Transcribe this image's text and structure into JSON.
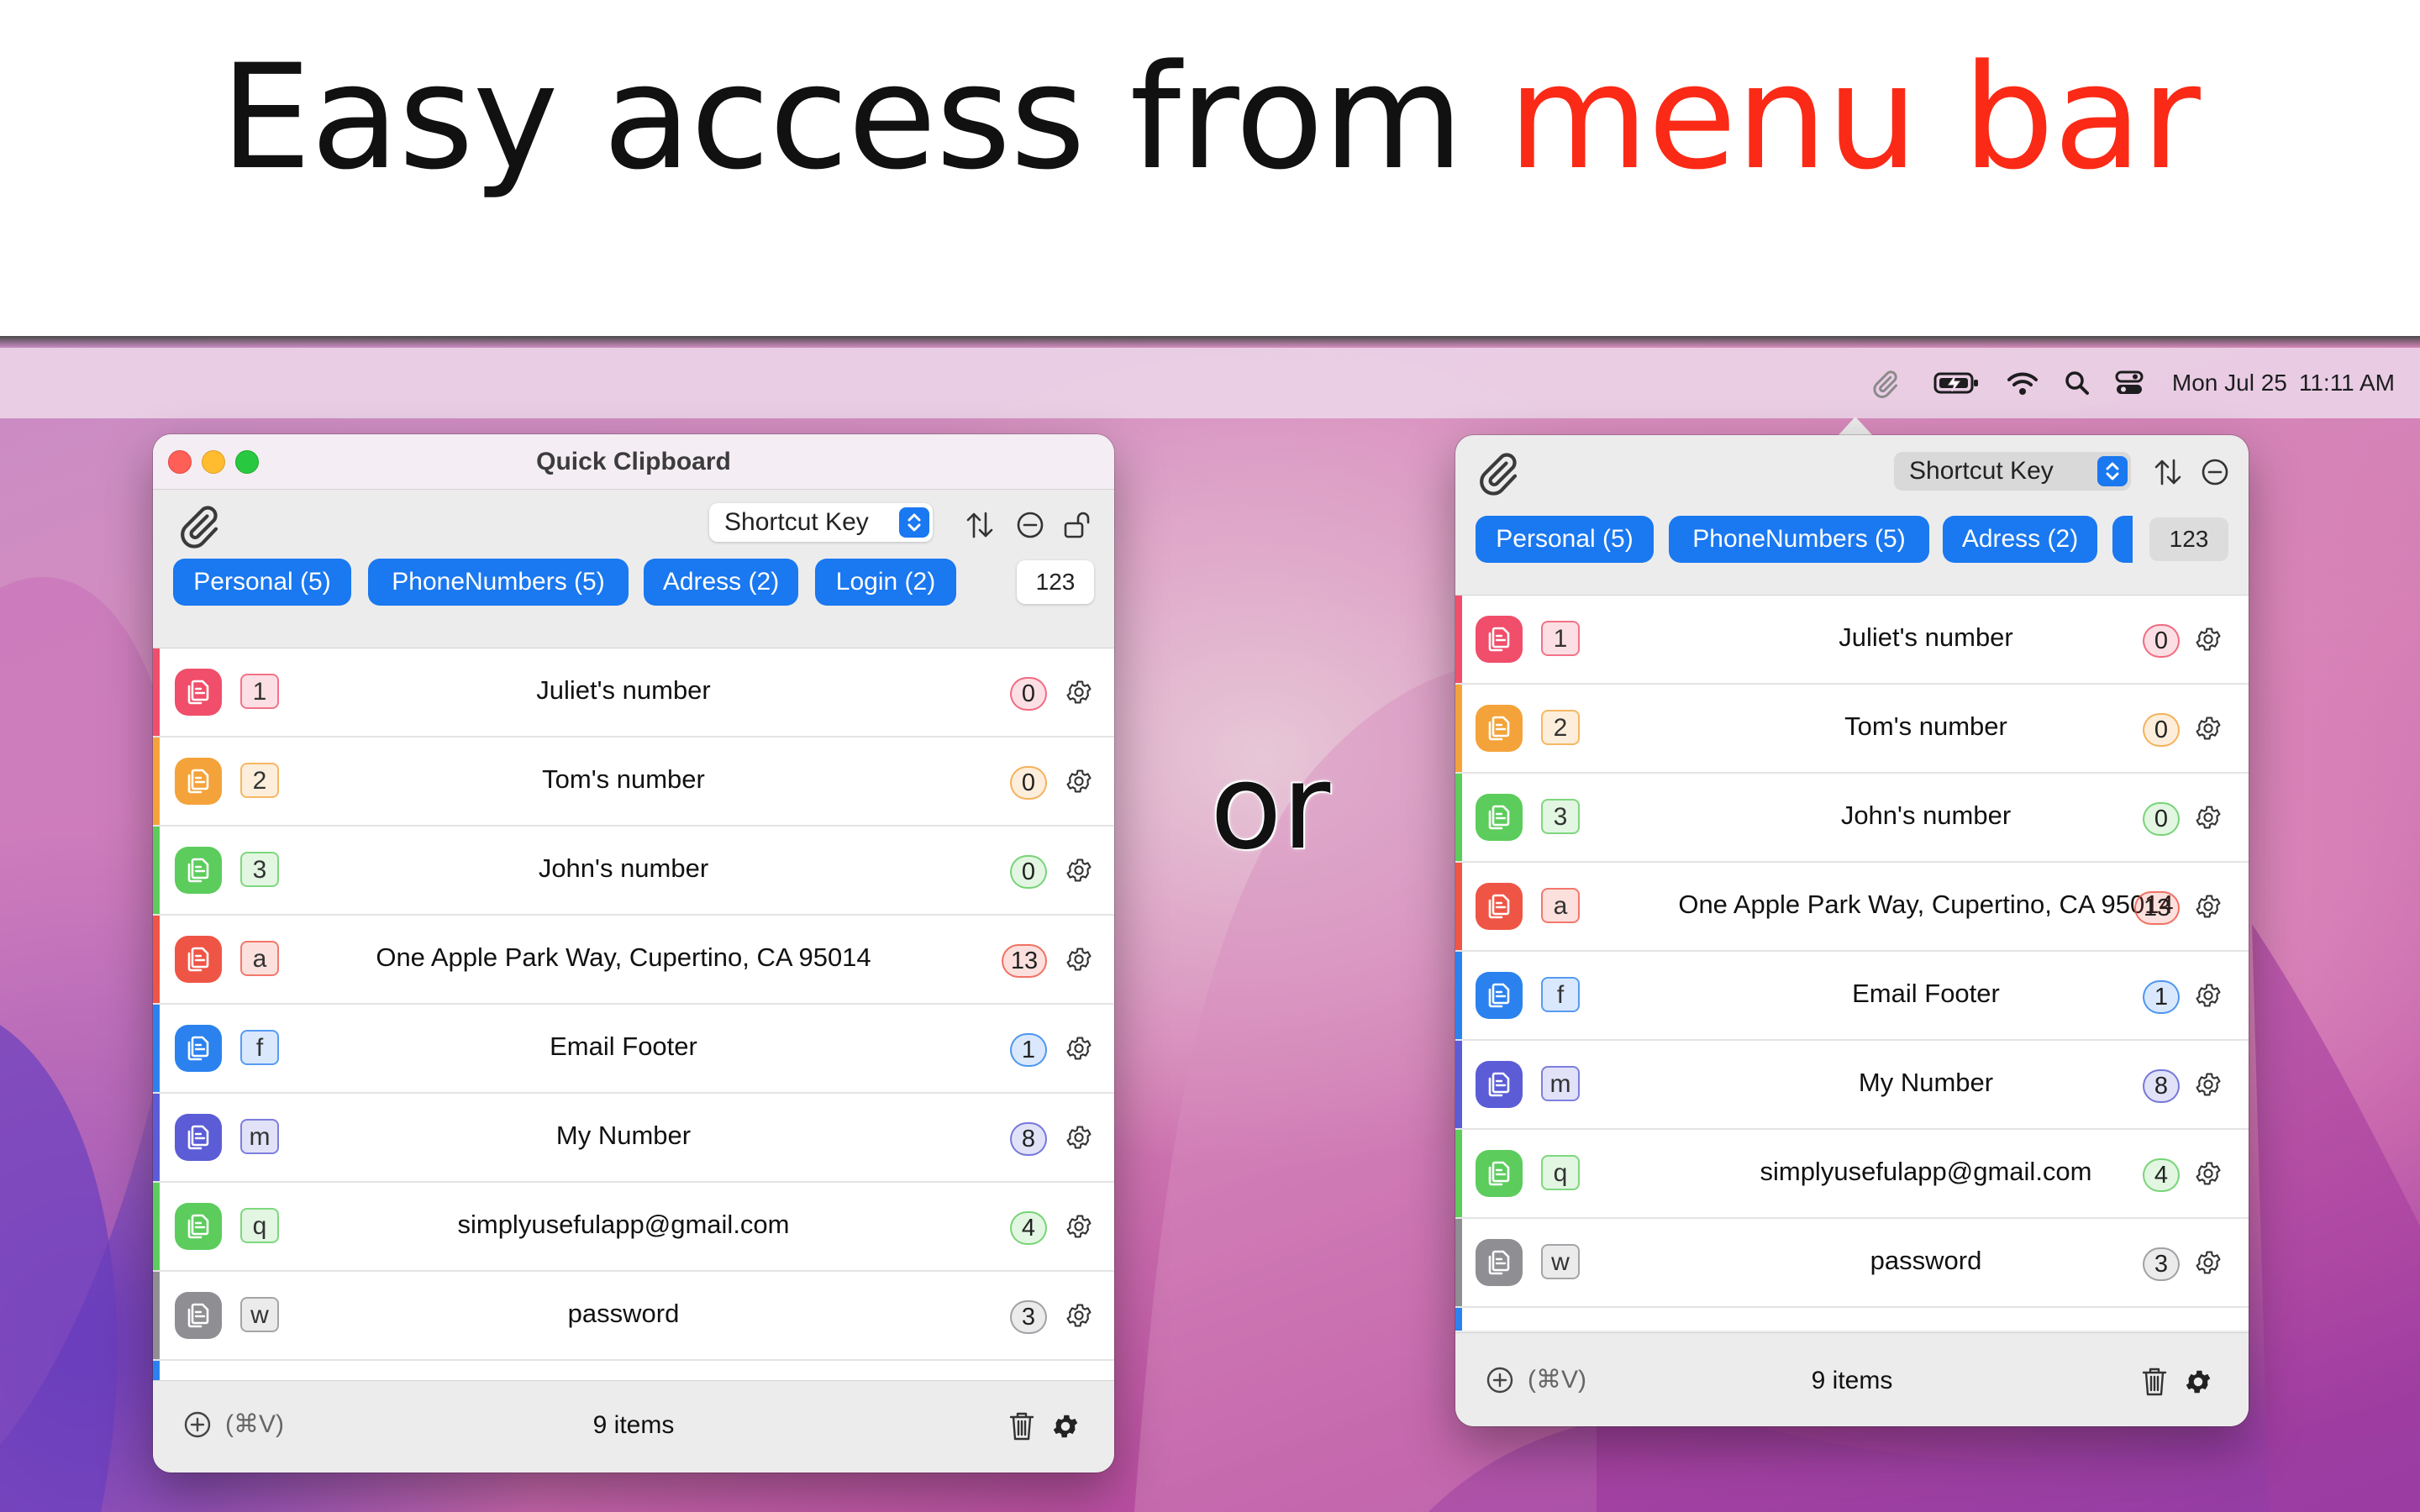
{
  "headline": {
    "text": "Easy access from ",
    "accent": "menu bar",
    "accent_color": "#fa2a17"
  },
  "separator_word": "or",
  "menubar": {
    "icons": [
      "paperclip-icon",
      "battery-charging-icon",
      "wifi-icon",
      "search-icon",
      "control-center-icon"
    ],
    "date": "Mon Jul 25",
    "time": "11:11 AM"
  },
  "app": {
    "window_title": "Quick Clipboard",
    "sort_select": "Shortcut Key",
    "tabs": [
      {
        "label": "Personal (5)"
      },
      {
        "label": "PhoneNumbers (5)"
      },
      {
        "label": "Adress (2)"
      },
      {
        "label": "Login (2)"
      }
    ],
    "count_box": "123",
    "items": [
      {
        "key": "1",
        "name": "Juliet's number",
        "uses": "0",
        "color": "#f04e6a"
      },
      {
        "key": "2",
        "name": "Tom's number",
        "uses": "0",
        "color": "#f4a33a"
      },
      {
        "key": "3",
        "name": "John's number",
        "uses": "0",
        "color": "#5ccc5c"
      },
      {
        "key": "a",
        "name": "One Apple Park Way, Cupertino, CA 95014",
        "uses": "13",
        "color": "#ef5545"
      },
      {
        "key": "f",
        "name": "Email Footer",
        "uses": "1",
        "color": "#2b82ef"
      },
      {
        "key": "m",
        "name": "My Number",
        "uses": "8",
        "color": "#5b5cd6"
      },
      {
        "key": "q",
        "name": "simplyusefulapp@gmail.com",
        "uses": "4",
        "color": "#5ccc5c"
      },
      {
        "key": "w",
        "name": "password",
        "uses": "3",
        "color": "#8e8e93"
      }
    ],
    "footer": {
      "add_shortcut": "(⌘V)",
      "count": "9 items"
    }
  }
}
